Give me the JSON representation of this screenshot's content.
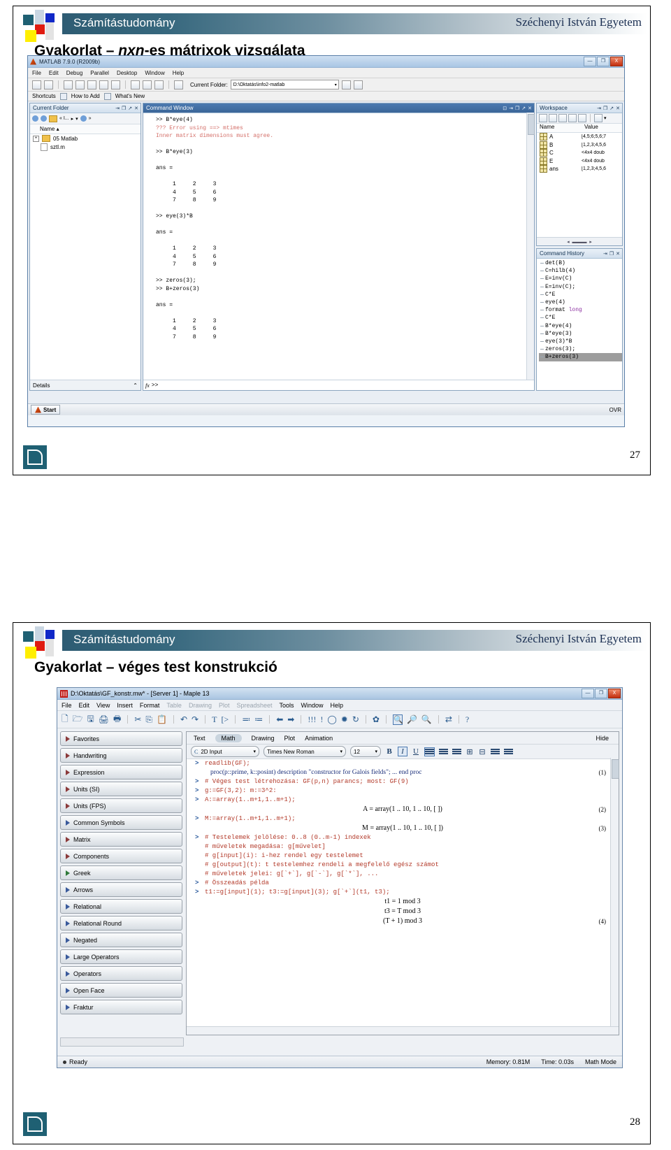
{
  "slide1": {
    "brand": {
      "title": "Számítástudomány",
      "university": "Széchenyi István Egyetem"
    },
    "title_prefix": "Gyakorlat – ",
    "title_italic": "nxn",
    "title_suffix": "-es mátrixok vizsgálata",
    "page_number": "27",
    "matlab": {
      "window_title": "MATLAB  7.9.0 (R2009b)",
      "win_buttons": {
        "minimize": "—",
        "maximize": "❐",
        "close": "X"
      },
      "menu": [
        "File",
        "Edit",
        "Debug",
        "Parallel",
        "Desktop",
        "Window",
        "Help"
      ],
      "toolbar": {
        "current_folder_label": "Current Folder:",
        "current_folder_value": "D:\\Oktatás\\info2-matlab"
      },
      "shortcuts_bar": [
        "Shortcuts",
        "How to Add",
        "What's New"
      ],
      "current_folder_panel": {
        "title": "Current Folder",
        "crumb": "« I...",
        "column_header": "Name",
        "items": [
          "05 Matlab",
          "sztl.m"
        ],
        "details_label": "Details"
      },
      "command_window": {
        "title": "Command Window",
        "lines": [
          ">> B*eye(4)",
          "??? Error using ==> mtimes",
          "Inner matrix dimensions must agree.",
          "",
          ">> B*eye(3)",
          "",
          "ans =",
          "",
          "     1     2     3",
          "     4     5     6",
          "     7     8     9",
          "",
          ">> eye(3)*B",
          "",
          "ans =",
          "",
          "     1     2     3",
          "     4     5     6",
          "     7     8     9",
          "",
          ">> zeros(3);",
          ">> B+zeros(3)",
          "",
          "ans =",
          "",
          "     1     2     3",
          "     4     5     6",
          "     7     8     9"
        ],
        "error_line_indices": [
          1,
          2
        ],
        "prompt": ">>"
      },
      "workspace": {
        "title": "Workspace",
        "columns": [
          "Name",
          "Value"
        ],
        "rows": [
          {
            "name": "A",
            "value": "[4,5;6;5,6;7"
          },
          {
            "name": "B",
            "value": "[1,2,3;4,5,6"
          },
          {
            "name": "C",
            "value": "<4x4 doub"
          },
          {
            "name": "E",
            "value": "<4x4 doub"
          },
          {
            "name": "ans",
            "value": "[1,2,3;4,5,6"
          }
        ]
      },
      "command_history": {
        "title": "Command History",
        "entries": [
          "det(B)",
          "C=hilb(4)",
          "E=inv(C)",
          "E=inv(C);",
          "C*E",
          "eye(4)",
          "format long",
          "C*E",
          "B*eye(4)",
          "B*eye(3)",
          "eye(3)*B",
          "zeros(3);",
          "B+zeros(3)"
        ],
        "keyword_entry_index": 6,
        "keyword_text": "long",
        "selected_entry_index": 12
      },
      "status": {
        "start_label": "Start",
        "mode": "OVR"
      }
    }
  },
  "slide2": {
    "brand": {
      "title": "Számítástudomány",
      "university": "Széchenyi István Egyetem"
    },
    "title": "Gyakorlat – véges test konstrukció",
    "page_number": "28",
    "maple": {
      "window_title": "D:\\Oktatás\\GF_konstr.mw* - [Server 1] - Maple 13",
      "win_buttons": {
        "minimize": "—",
        "maximize": "❐",
        "close": "X"
      },
      "menu": [
        {
          "label": "File",
          "enabled": true
        },
        {
          "label": "Edit",
          "enabled": true
        },
        {
          "label": "View",
          "enabled": true
        },
        {
          "label": "Insert",
          "enabled": true
        },
        {
          "label": "Format",
          "enabled": true
        },
        {
          "label": "Table",
          "enabled": false
        },
        {
          "label": "Drawing",
          "enabled": false
        },
        {
          "label": "Plot",
          "enabled": false
        },
        {
          "label": "Spreadsheet",
          "enabled": false
        },
        {
          "label": "Tools",
          "enabled": true
        },
        {
          "label": "Window",
          "enabled": true
        },
        {
          "label": "Help",
          "enabled": true
        }
      ],
      "palettes": [
        {
          "label": "Favorites",
          "color": "red"
        },
        {
          "label": "Handwriting",
          "color": "red"
        },
        {
          "label": "Expression",
          "color": "red"
        },
        {
          "label": "Units (SI)",
          "color": "red"
        },
        {
          "label": "Units (FPS)",
          "color": "red"
        },
        {
          "label": "Common Symbols",
          "color": "blue"
        },
        {
          "label": "Matrix",
          "color": "red"
        },
        {
          "label": "Components",
          "color": "red"
        },
        {
          "label": "Greek",
          "color": "green"
        },
        {
          "label": "Arrows",
          "color": "blue"
        },
        {
          "label": "Relational",
          "color": "blue"
        },
        {
          "label": "Relational Round",
          "color": "blue"
        },
        {
          "label": "Negated",
          "color": "blue"
        },
        {
          "label": "Large Operators",
          "color": "blue"
        },
        {
          "label": "Operators",
          "color": "blue"
        },
        {
          "label": "Open Face",
          "color": "blue"
        },
        {
          "label": "Fraktur",
          "color": "blue"
        }
      ],
      "context_tabs": [
        "Text",
        "Math",
        "Drawing",
        "Plot",
        "Animation"
      ],
      "context_tab_selected": "Math",
      "hide_label": "Hide",
      "format_bar": {
        "mode": "2D Input",
        "font": "Times New Roman",
        "size": "12",
        "bold": "B",
        "italic": "I",
        "underline": "U"
      },
      "document_lines": [
        {
          "prompt": ">",
          "text": "readlib(GF);",
          "type": "input"
        },
        {
          "prompt": "",
          "text": "proc(p::prime, k::posint) description \"constructor for Galois fields\"; ... end proc",
          "type": "navy",
          "eq": "(1)"
        },
        {
          "prompt": ">",
          "text": "# Véges test létrehozása: GF(p,n) parancs; most: GF(9)",
          "type": "input"
        },
        {
          "prompt": ">",
          "text": "g:=GF(3,2): m:=3^2:",
          "type": "input"
        },
        {
          "prompt": ">",
          "text": "A:=array(1..m+1,1..m+1);",
          "type": "input"
        },
        {
          "prompt": "",
          "text": "A = array(1 .. 10, 1 .. 10, [ ])",
          "type": "output",
          "eq": "(2)"
        },
        {
          "prompt": ">",
          "text": "M:=array(1..m+1,1..m+1);",
          "type": "input"
        },
        {
          "prompt": "",
          "text": "M = array(1 .. 10, 1 .. 10, [ ])",
          "type": "output",
          "eq": "(3)"
        },
        {
          "prompt": ">",
          "text": "# Testelemek jelölése: 0..8 (0..m-1) indexek",
          "type": "input"
        },
        {
          "prompt": "",
          "text": "# műveletek megadása: g[művelet]",
          "type": "input"
        },
        {
          "prompt": "",
          "text": "# g[input](i): i-hez rendel egy testelemet",
          "type": "input"
        },
        {
          "prompt": "",
          "text": "# g[output](t): t testelemhez rendeli a megfelelő egész számot",
          "type": "input"
        },
        {
          "prompt": "",
          "text": "# műveletek jelei: g[`+`], g[`-`], g[`*`], ...",
          "type": "input"
        },
        {
          "prompt": ">",
          "text": "# Összeadás példa",
          "type": "input"
        },
        {
          "prompt": ">",
          "text": "t1:=g[input](1); t3:=g[input](3); g[`+`](t1, t3);",
          "type": "input"
        },
        {
          "prompt": "",
          "text": "t1 = 1 mod 3",
          "type": "output"
        },
        {
          "prompt": "",
          "text": "t3 = T mod 3",
          "type": "output"
        },
        {
          "prompt": "",
          "text": "(T + 1) mod 3",
          "type": "output",
          "eq": "(4)"
        }
      ],
      "status": {
        "ready": "Ready",
        "memory": "Memory: 0.81M",
        "time": "Time: 0.03s",
        "mode": "Math Mode"
      }
    }
  }
}
